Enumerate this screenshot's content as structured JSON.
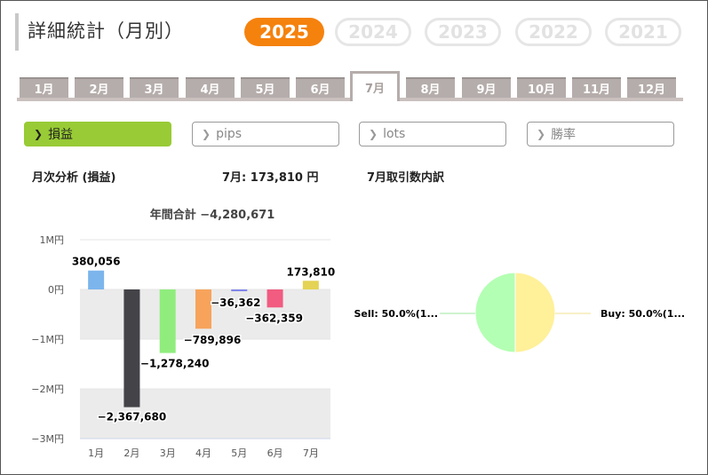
{
  "header": {
    "title": "詳細統計（月別）",
    "years": [
      "2025",
      "2024",
      "2023",
      "2022",
      "2021"
    ],
    "active_year": "2025"
  },
  "months": [
    "1月",
    "2月",
    "3月",
    "4月",
    "5月",
    "6月",
    "7月",
    "8月",
    "9月",
    "10月",
    "11月",
    "12月"
  ],
  "active_month": "7月",
  "metrics": [
    {
      "label": "損益",
      "icon": "chevron-right-icon",
      "active": true
    },
    {
      "label": "pips",
      "icon": "chevron-right-icon",
      "active": false
    },
    {
      "label": "lots",
      "icon": "chevron-right-icon",
      "active": false
    },
    {
      "label": "勝率",
      "icon": "chevron-right-icon",
      "active": false
    }
  ],
  "colors": {
    "active_year": "#f5820d",
    "active_metric": "#98cb35",
    "tab": "#b5adab"
  },
  "monthly_panel": {
    "heading": "月次分析 (損益)",
    "selected_value": "7月:  173,810 円"
  },
  "breakdown_panel": {
    "heading": "7月取引数内訳"
  },
  "chart_data": [
    {
      "type": "bar",
      "title": "年間合計 −4,280,671",
      "categories": [
        "1月",
        "2月",
        "3月",
        "4月",
        "5月",
        "6月",
        "7月"
      ],
      "values": [
        380056,
        -2367680,
        -1278240,
        -789896,
        -36362,
        -362359,
        173810
      ],
      "data_labels": [
        "380,056",
        "−2,367,680",
        "−1,278,240",
        "−789,896",
        "−36,362",
        "−362,359",
        "173,810"
      ],
      "colors": [
        "#7cb5ec",
        "#434348",
        "#90ed7d",
        "#f7a35c",
        "#8085e9",
        "#f15c80",
        "#e4d354"
      ],
      "ylim": [
        -3000000,
        1000000
      ],
      "yticks": [
        1000000,
        0,
        -1000000,
        -2000000,
        -3000000
      ],
      "ytick_labels": [
        "1M円",
        "0円",
        "−1M円",
        "−2M円",
        "−3M円"
      ],
      "grid": "alternating bands"
    },
    {
      "type": "pie",
      "slices": [
        {
          "label": "Sell: 50.0%(1...",
          "value": 50.0,
          "color": "#b3ffb3"
        },
        {
          "label": "Buy: 50.0%(1...",
          "value": 50.0,
          "color": "#fff09a"
        }
      ]
    }
  ]
}
